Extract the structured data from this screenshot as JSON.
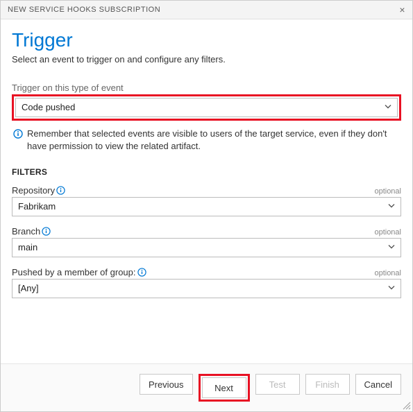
{
  "dialog": {
    "title": "NEW SERVICE HOOKS SUBSCRIPTION"
  },
  "page": {
    "heading": "Trigger",
    "subtitle": "Select an event to trigger on and configure any filters."
  },
  "event": {
    "label": "Trigger on this type of event",
    "value": "Code pushed"
  },
  "info": {
    "text": "Remember that selected events are visible to users of the target service, even if they don't have permission to view the related artifact."
  },
  "filters": {
    "heading": "FILTERS",
    "optional_label": "optional",
    "repository": {
      "label": "Repository",
      "value": "Fabrikam"
    },
    "branch": {
      "label": "Branch",
      "value": "main"
    },
    "group": {
      "label": "Pushed by a member of group:",
      "value": "[Any]"
    }
  },
  "footer": {
    "previous": "Previous",
    "next": "Next",
    "test": "Test",
    "finish": "Finish",
    "cancel": "Cancel"
  }
}
